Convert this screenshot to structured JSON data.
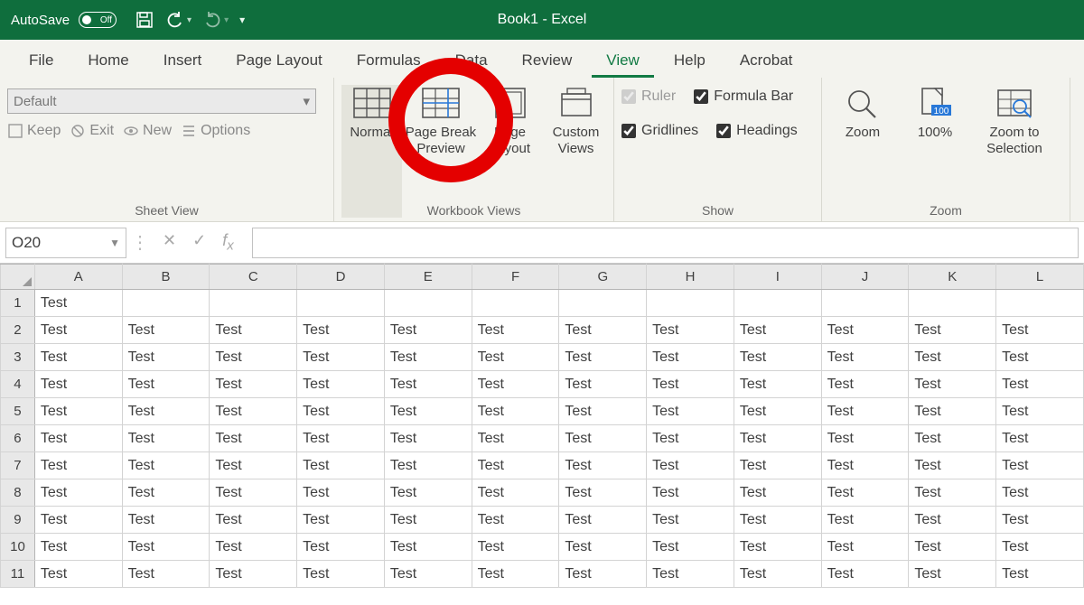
{
  "title": "Book1  -  Excel",
  "autosave": {
    "label": "AutoSave",
    "state": "Off"
  },
  "tabs": [
    "File",
    "Home",
    "Insert",
    "Page Layout",
    "Formulas",
    "Data",
    "Review",
    "View",
    "Help",
    "Acrobat"
  ],
  "active_tab": "View",
  "sheet_view": {
    "dropdown_value": "Default",
    "keep": "Keep",
    "exit": "Exit",
    "new": "New",
    "options": "Options",
    "label": "Sheet View"
  },
  "workbook_views": {
    "normal": "Normal",
    "page_break": "Page Break Preview",
    "page_layout": "Page Layout",
    "custom": "Custom Views",
    "label": "Workbook Views"
  },
  "show": {
    "ruler": "Ruler",
    "formula_bar": "Formula Bar",
    "gridlines": "Gridlines",
    "headings": "Headings",
    "label": "Show"
  },
  "zoom": {
    "zoom": "Zoom",
    "hundred": "100%",
    "to_sel": "Zoom to Selection",
    "label": "Zoom"
  },
  "namebox": "O20",
  "formula": "",
  "columns": [
    "A",
    "B",
    "C",
    "D",
    "E",
    "F",
    "G",
    "H",
    "I",
    "J",
    "K",
    "L"
  ],
  "rows": [
    {
      "n": 1,
      "cells": [
        "Test",
        "",
        "",
        "",
        "",
        "",
        "",
        "",
        "",
        "",
        "",
        ""
      ]
    },
    {
      "n": 2,
      "cells": [
        "Test",
        "Test",
        "Test",
        "Test",
        "Test",
        "Test",
        "Test",
        "Test",
        "Test",
        "Test",
        "Test",
        "Test"
      ]
    },
    {
      "n": 3,
      "cells": [
        "Test",
        "Test",
        "Test",
        "Test",
        "Test",
        "Test",
        "Test",
        "Test",
        "Test",
        "Test",
        "Test",
        "Test"
      ]
    },
    {
      "n": 4,
      "cells": [
        "Test",
        "Test",
        "Test",
        "Test",
        "Test",
        "Test",
        "Test",
        "Test",
        "Test",
        "Test",
        "Test",
        "Test"
      ]
    },
    {
      "n": 5,
      "cells": [
        "Test",
        "Test",
        "Test",
        "Test",
        "Test",
        "Test",
        "Test",
        "Test",
        "Test",
        "Test",
        "Test",
        "Test"
      ]
    },
    {
      "n": 6,
      "cells": [
        "Test",
        "Test",
        "Test",
        "Test",
        "Test",
        "Test",
        "Test",
        "Test",
        "Test",
        "Test",
        "Test",
        "Test"
      ]
    },
    {
      "n": 7,
      "cells": [
        "Test",
        "Test",
        "Test",
        "Test",
        "Test",
        "Test",
        "Test",
        "Test",
        "Test",
        "Test",
        "Test",
        "Test"
      ]
    },
    {
      "n": 8,
      "cells": [
        "Test",
        "Test",
        "Test",
        "Test",
        "Test",
        "Test",
        "Test",
        "Test",
        "Test",
        "Test",
        "Test",
        "Test"
      ]
    },
    {
      "n": 9,
      "cells": [
        "Test",
        "Test",
        "Test",
        "Test",
        "Test",
        "Test",
        "Test",
        "Test",
        "Test",
        "Test",
        "Test",
        "Test"
      ]
    },
    {
      "n": 10,
      "cells": [
        "Test",
        "Test",
        "Test",
        "Test",
        "Test",
        "Test",
        "Test",
        "Test",
        "Test",
        "Test",
        "Test",
        "Test"
      ]
    },
    {
      "n": 11,
      "cells": [
        "Test",
        "Test",
        "Test",
        "Test",
        "Test",
        "Test",
        "Test",
        "Test",
        "Test",
        "Test",
        "Test",
        "Test"
      ]
    }
  ]
}
